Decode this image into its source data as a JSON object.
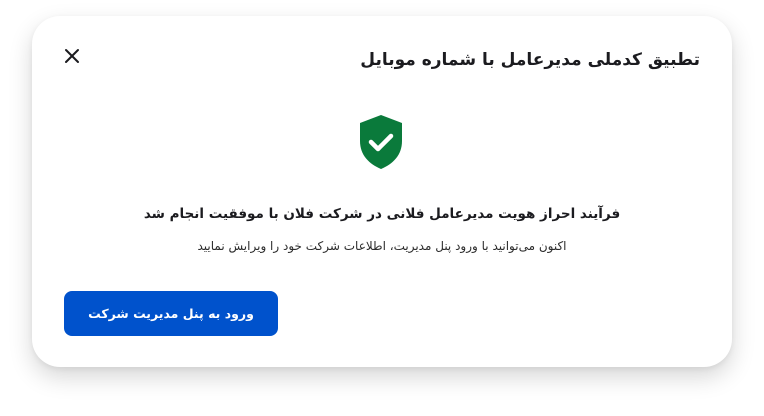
{
  "modal": {
    "title": "تطبیق کدملی مدیرعامل با شماره موبایل",
    "close_icon": "close-icon",
    "status_icon": "shield-check-icon",
    "message": "فرآیند احراز هویت مدیرعامل فلانی در شرکت فلان با موفقیت انجام شد",
    "sub_message": "اکنون می‌توانید با ورود پنل مدیریت، اطلاعات شرکت خود را ویرایش نمایید",
    "primary_button_label": "ورود به پنل مدیریت شرکت"
  },
  "colors": {
    "primary": "#0052cc",
    "success": "#0a7a3b",
    "text": "#1b1b1f"
  }
}
